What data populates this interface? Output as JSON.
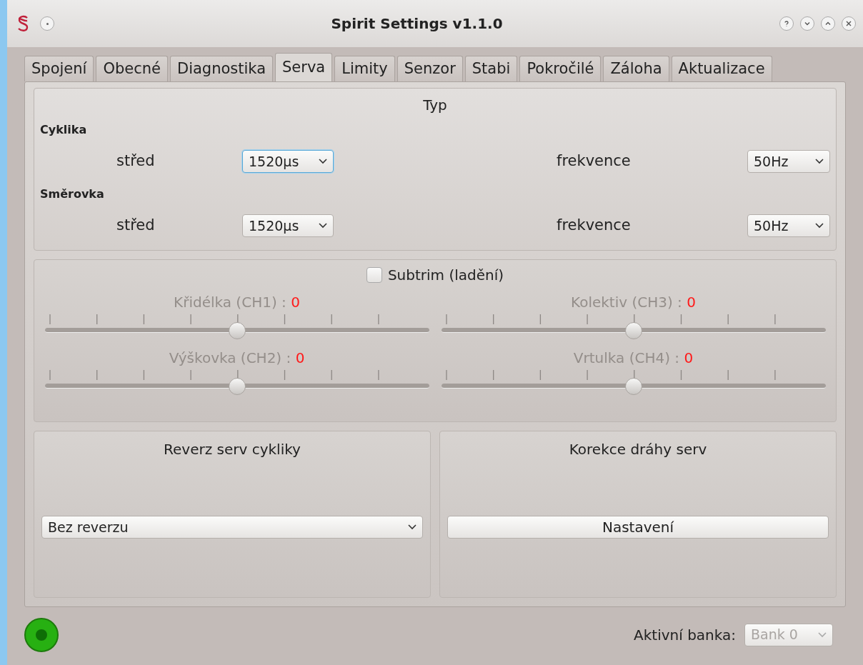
{
  "window": {
    "title": "Spirit Settings v1.1.0"
  },
  "tabs": [
    {
      "label": "Spojení",
      "selected": false
    },
    {
      "label": "Obecné",
      "selected": false
    },
    {
      "label": "Diagnostika",
      "selected": false
    },
    {
      "label": "Serva",
      "selected": true
    },
    {
      "label": "Limity",
      "selected": false
    },
    {
      "label": "Senzor",
      "selected": false
    },
    {
      "label": "Stabi",
      "selected": false
    },
    {
      "label": "Pokročilé",
      "selected": false
    },
    {
      "label": "Záloha",
      "selected": false
    },
    {
      "label": "Aktualizace",
      "selected": false
    }
  ],
  "type_section": {
    "title": "Typ",
    "groups": [
      {
        "name": "Cyklika",
        "center_label": "střed",
        "center_value": "1520μs",
        "center_focused": true,
        "freq_label": "frekvence",
        "freq_value": "50Hz"
      },
      {
        "name": "Směrovka",
        "center_label": "střed",
        "center_value": "1520μs",
        "center_focused": false,
        "freq_label": "frekvence",
        "freq_value": "50Hz"
      }
    ]
  },
  "subtrim": {
    "label": "Subtrim (ladění)",
    "checked": false,
    "sliders": [
      {
        "label": "Křidélka (CH1) :",
        "value": "0",
        "level": 0.5
      },
      {
        "label": "Kolektiv (CH3) :",
        "value": "0",
        "level": 0.5
      },
      {
        "label": "Výškovka (CH2) :",
        "value": "0",
        "level": 0.5
      },
      {
        "label": "Vrtulka (CH4) :",
        "value": "0",
        "level": 0.5
      }
    ]
  },
  "reverse": {
    "title": "Reverz serv cykliky",
    "value": "Bez reverzu"
  },
  "correction": {
    "title": "Korekce dráhy serv",
    "button": "Nastavení"
  },
  "status": {
    "connected": true
  },
  "bank": {
    "label": "Aktivní banka:",
    "value": "Bank 0",
    "disabled": true
  }
}
